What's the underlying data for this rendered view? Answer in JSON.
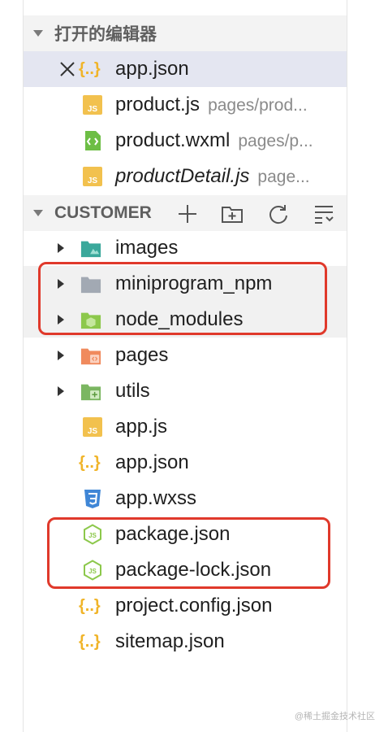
{
  "open_editors": {
    "title": "打开的编辑器",
    "items": [
      {
        "name": "app.json",
        "desc": ""
      },
      {
        "name": "product.js",
        "desc": "pages/prod..."
      },
      {
        "name": "product.wxml",
        "desc": "pages/p..."
      },
      {
        "name": "productDetail.js",
        "desc": "page..."
      }
    ]
  },
  "workspace": {
    "title": "CUSTOMER",
    "toolbar": [
      "new-file",
      "new-folder",
      "refresh",
      "collapse-all"
    ],
    "items": [
      {
        "name": "images",
        "type": "folder"
      },
      {
        "name": "miniprogram_npm",
        "type": "folder"
      },
      {
        "name": "node_modules",
        "type": "folder"
      },
      {
        "name": "pages",
        "type": "folder"
      },
      {
        "name": "utils",
        "type": "folder"
      },
      {
        "name": "app.js",
        "type": "js"
      },
      {
        "name": "app.json",
        "type": "json"
      },
      {
        "name": "app.wxss",
        "type": "css"
      },
      {
        "name": "package.json",
        "type": "node-json"
      },
      {
        "name": "package-lock.json",
        "type": "node-json"
      },
      {
        "name": "project.config.json",
        "type": "json"
      },
      {
        "name": "sitemap.json",
        "type": "json"
      }
    ]
  },
  "watermark": "@稀土掘金技术社区",
  "colors": {
    "highlight_box": "#e0392b",
    "js_icon": "#f2c14e",
    "json_icon": "#f0b429",
    "css_icon": "#3f86d6",
    "node_icon": "#8cc84b",
    "folder_teal": "#3aa89b",
    "folder_gray": "#a2a9b3",
    "folder_green": "#8cc84b",
    "folder_orange": "#f08a5d"
  }
}
